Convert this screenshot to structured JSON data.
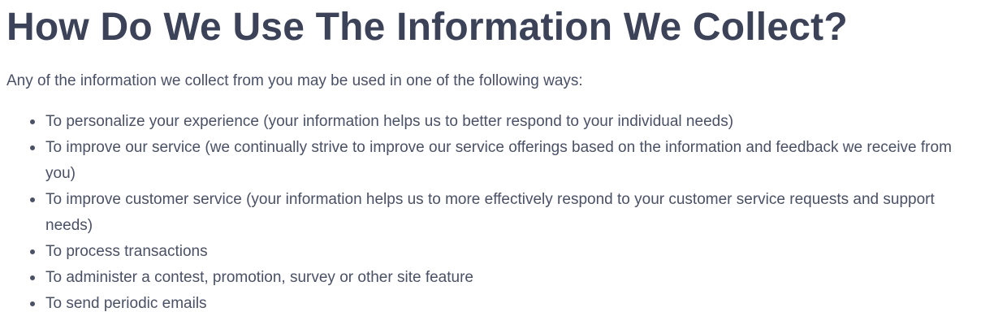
{
  "heading": "How Do We Use The Information We Collect?",
  "intro": "Any of the information we collect from you may be used in one of the following ways:",
  "uses": [
    "To personalize your experience (your information helps us to better respond to your individual needs)",
    "To improve our service (we continually strive to improve our service offerings based on the information and feedback we receive from you)",
    "To improve customer service (your information helps us to more effectively respond to your customer service requests and support needs)",
    "To process transactions",
    "To administer a contest, promotion, survey or other site feature",
    "To send periodic emails"
  ]
}
